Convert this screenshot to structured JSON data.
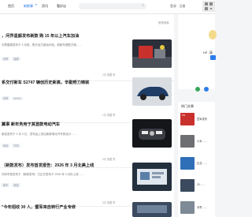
{
  "nav": {
    "items": [
      "首页",
      "新鲜事",
      "资讯",
      "看好店"
    ],
    "active_index": 1,
    "account": "登录 · 注册"
  },
  "main": {
    "corner_label": "推荐频道",
    "articles": [
      {
        "title": "，问界星舰发布新款 购 15 年以上汽车加油",
        "excerpt": "问界星舰发布于 3 月底，售价及方案及补贴；新款车搭配方案……",
        "tags": [
          "问界",
          "星舰"
        ],
        "stats": "2天   收藏   赞"
      },
      {
        "title": "系交付新车 S2747 辆创历史新高，辛勤努力铸就",
        "excerpt": "",
        "tags": [
          "问界",
          "S2747"
        ],
        "stats": "1天   收藏   赞"
      },
      {
        "title": "翼事 新年务用于其首款电动汽车",
        "excerpt": "新品发布于 2 月 9 日，发布会上亮出新款电动汽车的设计……",
        "tags": [
          "电动",
          "汽车"
        ],
        "stats": "4天   收藏   赞"
      },
      {
        "title": "（新款发布）发布首发报告：2026 年 3 月北美上线",
        "excerpt": "刘向车型发布于（新款发布）已正式发布于 2026 年 3 月份上线……",
        "tags": [
          "新车",
          "报告"
        ],
        "stats": "3天   收藏   赞"
      },
      {
        "title": "\"今年招收 30 人，暨军来自转行产业专修",
        "excerpt": "",
        "tags": [],
        "stats": ""
      }
    ]
  },
  "side": {
    "profile_id": "Hi！请",
    "hot_title": "热门文章",
    "hot_items": [
      {
        "text": "暨军发布"
      },
      {
        "text": "小米……"
      },
      {
        "text": "比亚……"
      },
      {
        "text": "20……"
      },
      {
        "text": "问界……"
      }
    ],
    "hot_badge": "PD"
  },
  "colors": {
    "accent": "#1a73e8",
    "follow": "#2b7de9",
    "text": "#222222",
    "muted": "#999999"
  }
}
